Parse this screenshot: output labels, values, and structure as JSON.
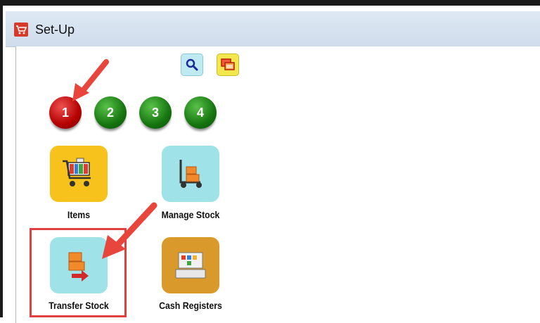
{
  "window": {
    "title": "Set-Up"
  },
  "toolbar": {
    "search_icon": "search-icon",
    "window_icon": "windows-icon"
  },
  "pages": [
    {
      "label": "1",
      "active": true,
      "color": "#b30000"
    },
    {
      "label": "2",
      "active": false,
      "color": "#15750f"
    },
    {
      "label": "3",
      "active": false,
      "color": "#15750f"
    },
    {
      "label": "4",
      "active": false,
      "color": "#15750f"
    }
  ],
  "modules": [
    {
      "label": "Items",
      "icon": "shopping-cart-icon",
      "bg": "#f6c21b"
    },
    {
      "label": "Manage Stock",
      "icon": "hand-truck-icon",
      "bg": "#9fe3e8"
    },
    {
      "label": "Transfer Stock",
      "icon": "transfer-boxes-icon",
      "bg": "#9fe3e8",
      "highlighted": true
    },
    {
      "label": "Cash Registers",
      "icon": "cash-register-icon",
      "bg": "#d99a2b"
    }
  ],
  "annotation_colors": {
    "arrow": "#e8453c",
    "highlight": "#e04040"
  }
}
